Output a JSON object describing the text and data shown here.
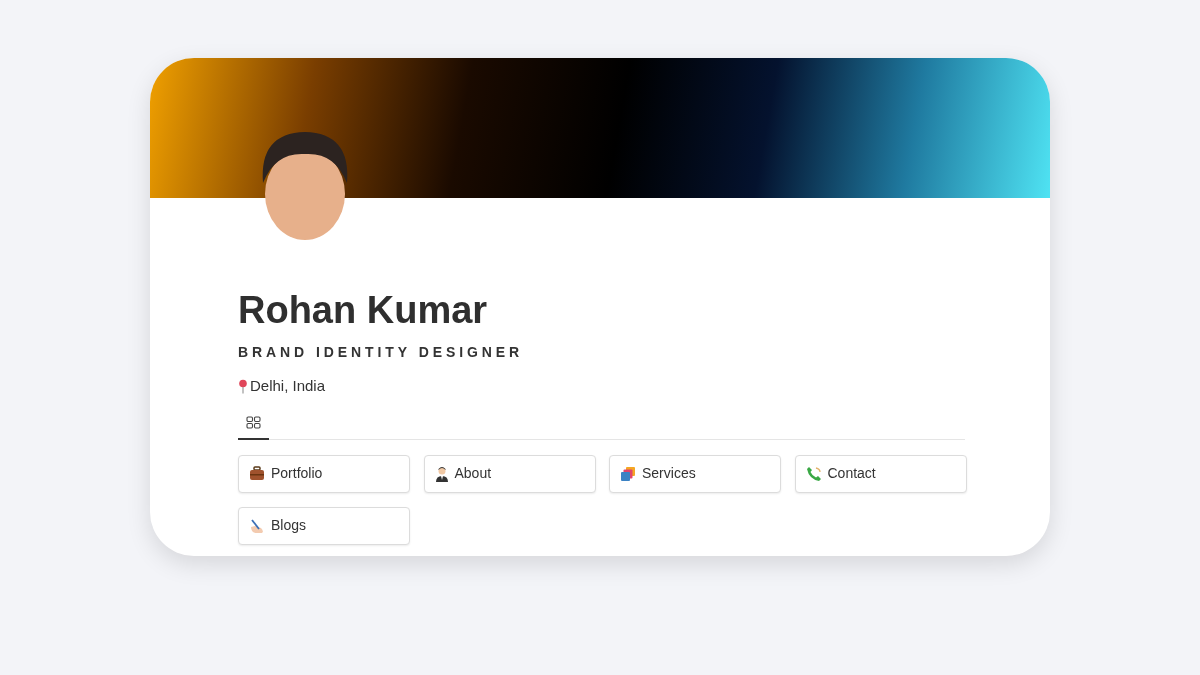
{
  "profile": {
    "name": "Rohan Kumar",
    "role": "BRAND IDENTITY DESIGNER",
    "location": "Delhi, India"
  },
  "tabs": [
    {
      "kind": "gallery",
      "selected": true
    }
  ],
  "links": [
    {
      "label": "Portfolio",
      "kind": "briefcase"
    },
    {
      "label": "About",
      "kind": "person"
    },
    {
      "label": "Services",
      "kind": "layers"
    },
    {
      "label": "Contact",
      "kind": "phone"
    },
    {
      "label": "Blogs",
      "kind": "writing"
    }
  ]
}
